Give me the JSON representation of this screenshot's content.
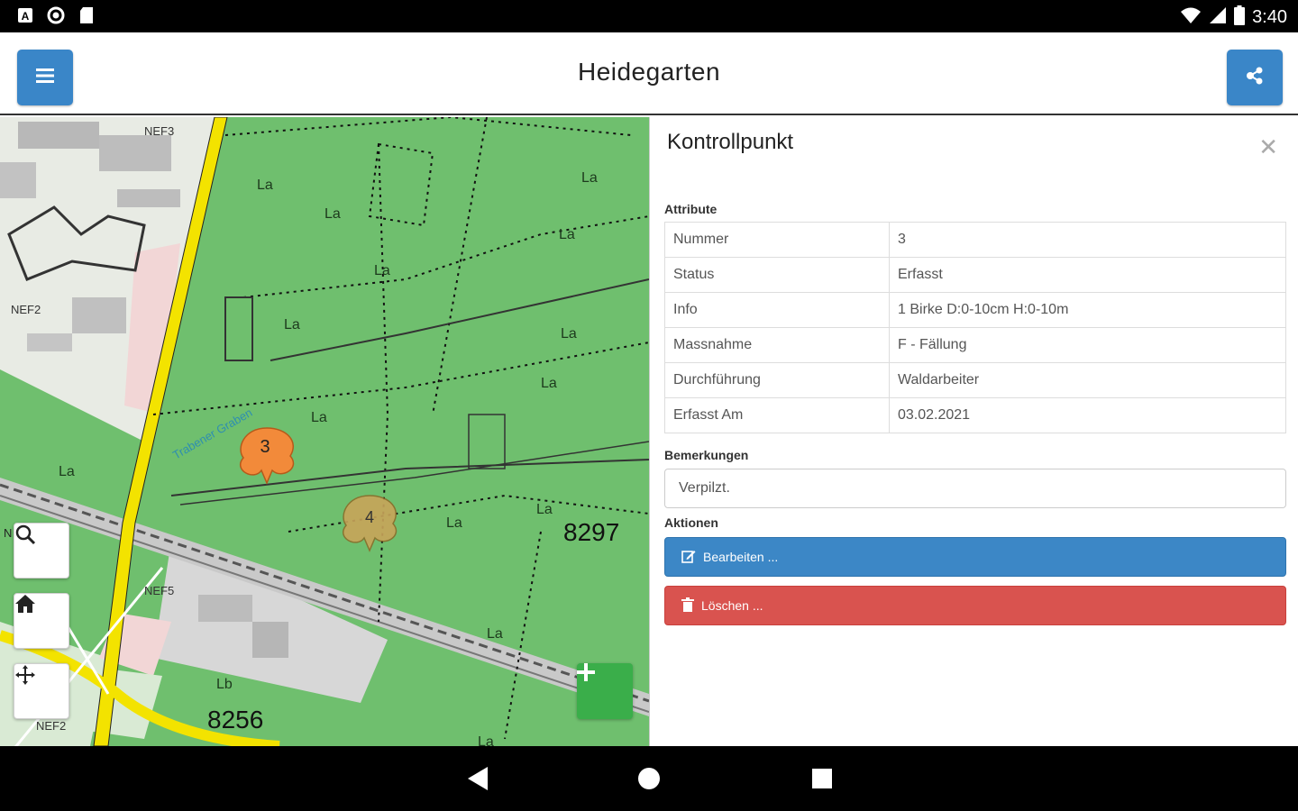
{
  "status_bar": {
    "time": "3:40",
    "icons": [
      "a-icon",
      "circle-icon",
      "sd-card-icon",
      "wifi-icon",
      "signal-icon",
      "battery-icon"
    ]
  },
  "header": {
    "title": "Heidegarten",
    "menu_icon": "hamburger-icon",
    "share_icon": "share-icon",
    "accent": "#3a86c8"
  },
  "map": {
    "labels": {
      "nef3": "NEF3",
      "nef2": "NEF2",
      "nef5": "NEF5",
      "nef2b": "NEF2",
      "n": "N",
      "la_a": "La",
      "la_b": "La",
      "la_c": "La",
      "la_d": "La",
      "la_e": "La",
      "la_f": "La",
      "la_g": "La",
      "la_h": "La",
      "la_i": "La",
      "la_j": "La",
      "la_k": "La",
      "la_l": "La",
      "la_m": "La",
      "la_n": "La",
      "lb": "Lb",
      "parcel_8297": "8297",
      "parcel_8256": "8256",
      "creek": "Trabener Graben"
    },
    "markers": [
      {
        "number": "3",
        "color": "#f28a3a"
      },
      {
        "number": "4",
        "color": "#c8a55a"
      }
    ],
    "controls": [
      "search-icon",
      "home-icon",
      "move-icon"
    ],
    "add_icon": "plus-icon"
  },
  "panel": {
    "title": "Kontrollpunkt",
    "attributes_label": "Attribute",
    "attributes": [
      {
        "key": "Nummer",
        "value": "3"
      },
      {
        "key": "Status",
        "value": "Erfasst"
      },
      {
        "key": "Info",
        "value": "1 Birke D:0-10cm H:0-10m"
      },
      {
        "key": "Massnahme",
        "value": "F - Fällung"
      },
      {
        "key": "Durchführung",
        "value": "Waldarbeiter"
      },
      {
        "key": "Erfasst Am",
        "value": "03.02.2021"
      }
    ],
    "remarks_label": "Bemerkungen",
    "remarks_value": "Verpilzt.",
    "actions_label": "Aktionen",
    "edit_label": "Bearbeiten ...",
    "delete_label": "Löschen ...",
    "edit_color": "#3c87c6",
    "delete_color": "#d9534f"
  },
  "nav": {
    "icons": [
      "back-icon",
      "home-circle-icon",
      "recents-icon"
    ]
  }
}
